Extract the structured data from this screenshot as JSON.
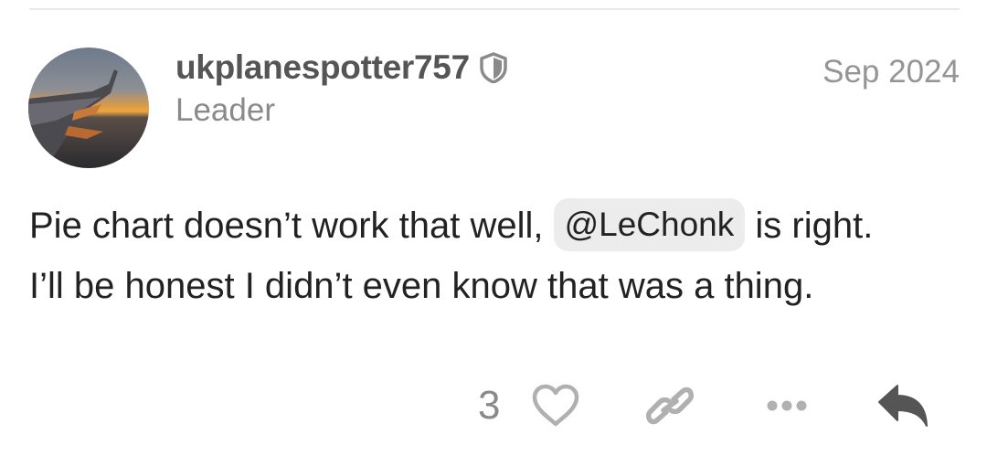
{
  "post": {
    "username": "ukplanespotter757",
    "user_title": "Leader",
    "date": "Sep 2024",
    "body_part1": "Pie chart doesn’t work that well, ",
    "mention": "@LeChonk",
    "body_part2": " is right.",
    "body_line2": "I’ll be honest I didn’t even know that was a thing.",
    "like_count": "3"
  },
  "icons": {
    "moderator_badge": "shield-icon",
    "like": "heart-icon",
    "copy_link": "link-icon",
    "more": "ellipsis-icon",
    "reply": "reply-arrow-icon"
  },
  "colors": {
    "username": "#555555",
    "muted_text": "#8a8a8a",
    "body_text": "#222222",
    "mention_bg": "#ececec",
    "action_icon": "#b0b0b0",
    "reply_icon": "#555555"
  }
}
